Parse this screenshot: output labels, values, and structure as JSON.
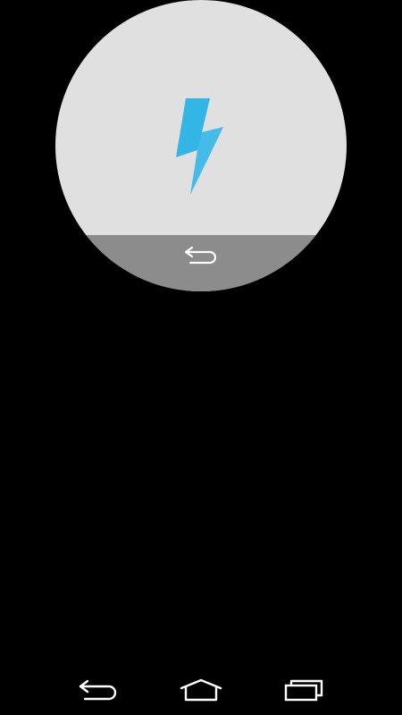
{
  "colors": {
    "background": "#000000",
    "watch_face": "#e0e0e0",
    "back_bar": "#8c8c8c",
    "bolt": "#33b5e5",
    "nav_icon": "#ffffff"
  },
  "watch": {
    "center_icon": "lightning-bolt-icon",
    "back_icon": "back-arrow-icon"
  },
  "nav_bar": {
    "items": [
      {
        "icon": "back-icon"
      },
      {
        "icon": "home-icon"
      },
      {
        "icon": "recent-apps-icon"
      }
    ]
  }
}
